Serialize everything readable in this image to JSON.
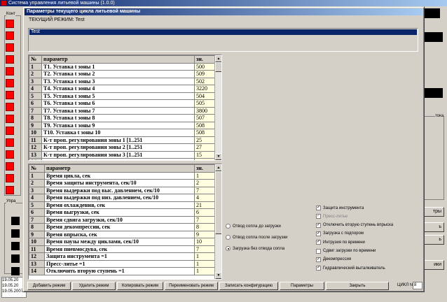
{
  "background_window": {
    "title": "Система управления литьевой машины (1.0.0)",
    "left_group_label": "Конт",
    "bottom_group_label": "Упра",
    "right_label": "тока",
    "right_buttons": [
      "тры",
      "ь",
      "ь",
      "ики"
    ],
    "log_lines": [
      "19.05.20",
      "19.05.20",
      "19.05.2007 09:40:39 Система запущена"
    ]
  },
  "dialog": {
    "title": "Параметры текущего цикла литьевой машины",
    "mode_label": "ТЕКУЩИЙ РЕЖИМ: Test",
    "modes": [
      "Test"
    ],
    "temp_table": {
      "headers": [
        "№",
        "параметр",
        "зн."
      ],
      "rows": [
        [
          "1",
          "T1. Уставка t зоны 1",
          "500"
        ],
        [
          "2",
          "T2. Уставка t зоны 2",
          "509"
        ],
        [
          "3",
          "T3. Уставка t зоны 3",
          "502"
        ],
        [
          "4",
          "T4. Уставка t зоны 4",
          "3220"
        ],
        [
          "5",
          "T5. Уставка t зоны 5",
          "504"
        ],
        [
          "6",
          "T6. Уставка t зоны 6",
          "505"
        ],
        [
          "7",
          "T7. Уставка t зоны 7",
          "3800"
        ],
        [
          "8",
          "T8. Уставка t зоны 8",
          "507"
        ],
        [
          "9",
          "T9. Уставка t зоны 9",
          "508"
        ],
        [
          "10",
          "T10. Уставка t зоны 10",
          "508"
        ],
        [
          "11",
          "К-т проп. регулирования зоны 1 [1..251",
          "25"
        ],
        [
          "12",
          "К-т проп. регулирования зоны 2 [1..251",
          "27"
        ],
        [
          "13",
          "К-т проп. регулирования зоны 3 [1..251",
          "15"
        ],
        [
          "14",
          "",
          ""
        ]
      ]
    },
    "time_table": {
      "headers": [
        "№",
        "параметр",
        "зн."
      ],
      "rows": [
        [
          "1",
          "Время цикла, сек",
          "1"
        ],
        [
          "2",
          "Время защиты инструмента, сек/10",
          "2"
        ],
        [
          "3",
          "Время выдержки под выс. давлением, сек/10",
          "7"
        ],
        [
          "4",
          "Время выдержки под низ. давлением, сек/10",
          "4"
        ],
        [
          "5",
          "Время охлаждения, сек",
          "21"
        ],
        [
          "6",
          "Время выгрузки, сек",
          "6"
        ],
        [
          "7",
          "Время сдвига загрузки, сек/10",
          "7"
        ],
        [
          "8",
          "Время декомпрессии, сек",
          "8"
        ],
        [
          "9",
          "Время впрыска, сек",
          "9"
        ],
        [
          "10",
          "Время паузы между циклами, сек/10",
          "10"
        ],
        [
          "11",
          "Время пневмосдува, сек",
          "7"
        ],
        [
          "12",
          "Защита инструмента =1",
          "1"
        ],
        [
          "13",
          "Пресс-литье =1",
          "1"
        ],
        [
          "14",
          "Отключить вторую ступень =1",
          "1"
        ]
      ]
    },
    "radios": [
      {
        "label": "Отвод сопла до загрузки",
        "checked": false
      },
      {
        "label": "Отвод сопла после загрузки",
        "checked": false
      },
      {
        "label": "Загрузка без отвода сопла",
        "checked": true
      }
    ],
    "checkboxes": [
      {
        "label": "Защита инструмента",
        "checked": true,
        "disabled": false
      },
      {
        "label": "Пресс-литье",
        "checked": true,
        "disabled": true
      },
      {
        "label": "Отключить вторую ступень впрыска",
        "checked": true,
        "disabled": false
      },
      {
        "label": "Загрузка с подпором",
        "checked": true,
        "disabled": false
      },
      {
        "label": "Интрузия по времени",
        "checked": true,
        "disabled": false
      },
      {
        "label": "Сдвиг загрузки по времени",
        "checked": false,
        "disabled": false
      },
      {
        "label": "Декомпрессия",
        "checked": true,
        "disabled": false
      },
      {
        "label": "Гидравлический выталкиватель",
        "checked": true,
        "disabled": false
      }
    ],
    "buttons": {
      "add_mode": "Добавить режим",
      "delete_mode": "Удалить режим",
      "copy_mode": "Копировать режим",
      "rename_mode": "Переименовать режим",
      "save_config": "Записать конфигурацию",
      "params": "Параметры",
      "close": "Закрыть"
    },
    "cycle_label": "ЦИКЛ №:",
    "cycle_value": "8"
  }
}
